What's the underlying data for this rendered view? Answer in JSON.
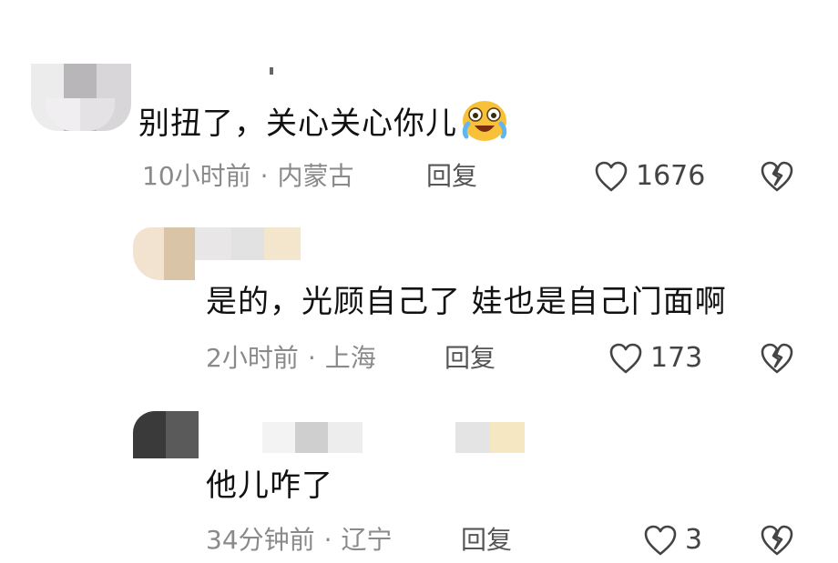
{
  "comments": [
    {
      "text": "别扭了，关心关心你儿",
      "emoji": "laugh-cry-emoji",
      "time": "10小时前",
      "location": "内蒙古",
      "reply_label": "回复",
      "likes": "1676"
    },
    {
      "text": "是的，光顾自己了 娃也是自己门面啊",
      "time": "2小时前",
      "location": "上海",
      "reply_label": "回复",
      "likes": "173"
    },
    {
      "text": "他儿咋了",
      "time": "34分钟前",
      "location": "辽宁",
      "reply_label": "回复",
      "likes": "3"
    }
  ],
  "separator": "·",
  "colors": {
    "text": "#111111",
    "meta": "#8a8a8a",
    "icon": "#444444"
  }
}
